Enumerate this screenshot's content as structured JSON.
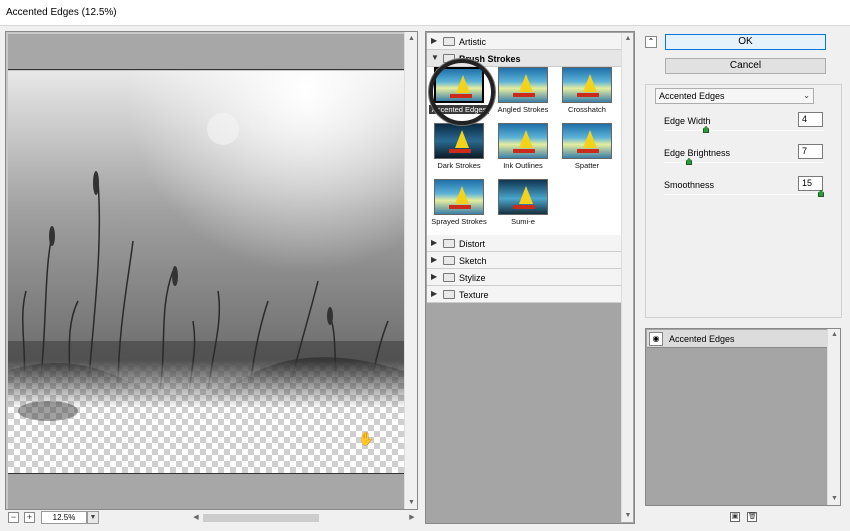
{
  "window": {
    "title": "Accented Edges (12.5%)"
  },
  "preview": {
    "zoom": "12.5%",
    "zoom_out": "−",
    "zoom_in": "+"
  },
  "gallery": {
    "categories_top": [
      "Artistic",
      "Brush Strokes"
    ],
    "thumbs": [
      {
        "label": "Accented Edges"
      },
      {
        "label": "Angled Strokes"
      },
      {
        "label": "Crosshatch"
      },
      {
        "label": "Dark Strokes"
      },
      {
        "label": "Ink Outlines"
      },
      {
        "label": "Spatter"
      },
      {
        "label": "Sprayed Strokes"
      },
      {
        "label": "Sumi-e"
      }
    ],
    "categories_bottom": [
      "Distort",
      "Sketch",
      "Stylize",
      "Texture"
    ]
  },
  "actions": {
    "ok": "OK",
    "cancel": "Cancel"
  },
  "settings": {
    "filter": "Accented Edges",
    "params": [
      {
        "label": "Edge Width",
        "value": "4",
        "level": 0.25
      },
      {
        "label": "Edge Brightness",
        "value": "7",
        "level": 0.14
      },
      {
        "label": "Smoothness",
        "value": "15",
        "level": 1.0
      }
    ]
  },
  "layers": {
    "current": "Accented Edges"
  },
  "icons": {
    "collapse": "double-chevron-up-icon",
    "eye": "eye-icon",
    "new_layer": "new-layer-icon",
    "delete": "trash-icon",
    "hand": "hand-icon"
  }
}
